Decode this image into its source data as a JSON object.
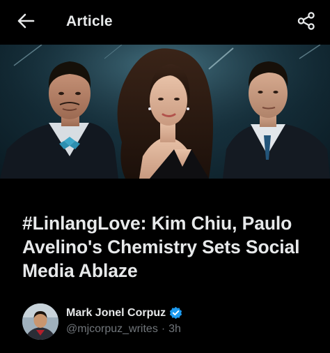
{
  "header": {
    "title": "Article",
    "back_icon": "arrow-left-icon",
    "share_icon": "share-icon"
  },
  "hero": {
    "image_description_icon": "article-hero-image"
  },
  "article": {
    "headline": "#LinlangLove: Kim Chiu, Paulo Avelino's Chemistry Sets Social Media Ablaze"
  },
  "author": {
    "name": "Mark Jonel Corpuz",
    "handle": "@mjcorpuz_writes",
    "separator": "·",
    "time": "3h",
    "verified_color": "#1d9bf0"
  },
  "colors": {
    "background": "#000000",
    "text_primary": "#e7e9ea",
    "text_secondary": "#71767b",
    "accent": "#1d9bf0"
  }
}
